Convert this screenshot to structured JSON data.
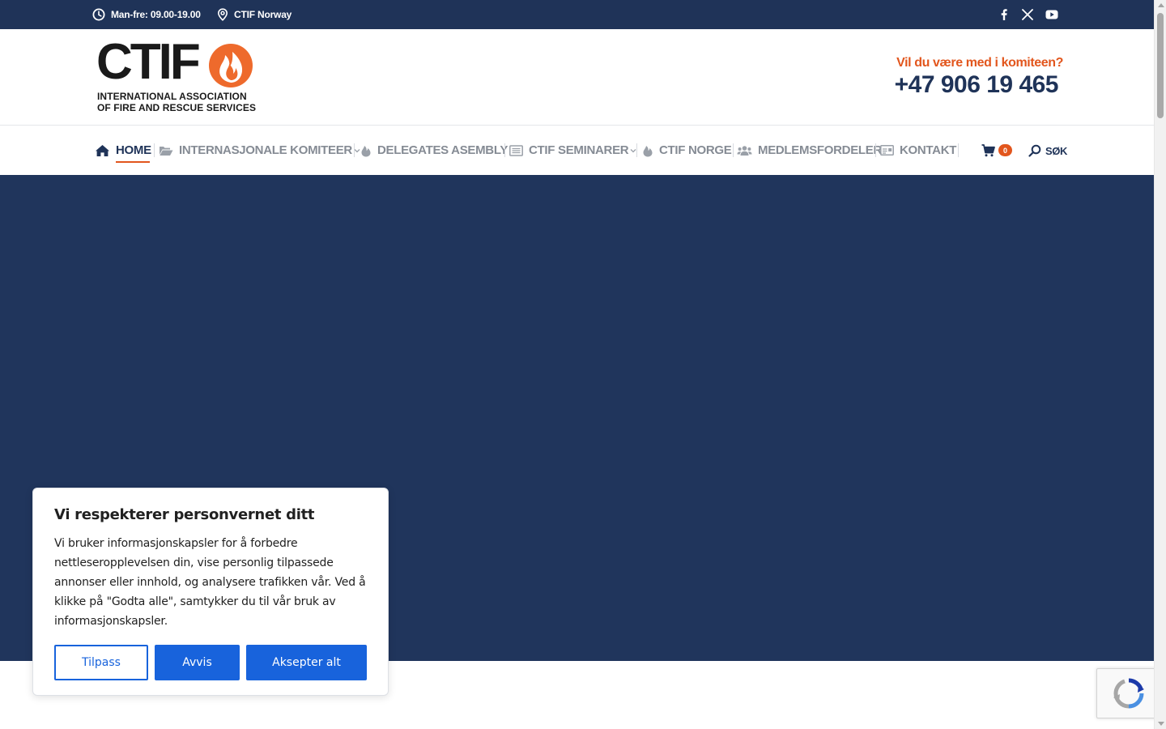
{
  "topbar": {
    "hours": "Man-fre: 09.00-19.00",
    "location": "CTIF Norway",
    "social": [
      "facebook-icon",
      "x-twitter-icon",
      "youtube-icon"
    ]
  },
  "logo": {
    "word": "CTIF",
    "line1": "INTERNATIONAL  ASSOCIATION",
    "line2": "OF FIRE AND RESCUE SERVICES"
  },
  "header": {
    "phone_question": "Vil du være med i komiteen?",
    "phone_number": "+47 906 19 465"
  },
  "nav": {
    "items": [
      {
        "label": "HOME",
        "icon": "home-icon",
        "active": true
      },
      {
        "label": "INTERNASJONALE KOMITEER",
        "icon": "folder-open-icon",
        "dropdown": true
      },
      {
        "label": "DELEGATES ASEMBLY",
        "icon": "fire-icon"
      },
      {
        "label": "CTIF SEMINARER",
        "icon": "list-icon",
        "dropdown": true
      },
      {
        "label": "CTIF NORGE",
        "icon": "fire-icon"
      },
      {
        "label": "MEDLEMSFORDELER",
        "icon": "users-icon"
      },
      {
        "label": "KONTAKT",
        "icon": "contact-card-icon"
      }
    ],
    "cart_count": "0",
    "search_label": "SØK"
  },
  "colors": {
    "navy": "#1f3358",
    "hero": "#20355c",
    "accent": "#e2561d",
    "button_blue": "#1863dc"
  },
  "cookie": {
    "title": "Vi respekterer personvernet ditt",
    "text": "Vi bruker informasjonskapsler for å forbedre nettleseropplevelsen din, vise personlig tilpassede annonser eller innhold, og analysere trafikken vår. Ved å klikke på \"Godta alle\", samtykker du til vår bruk av informasjonskapsler.",
    "btn_customize": "Tilpass",
    "btn_reject": "Avvis",
    "btn_accept": "Aksepter alt"
  }
}
